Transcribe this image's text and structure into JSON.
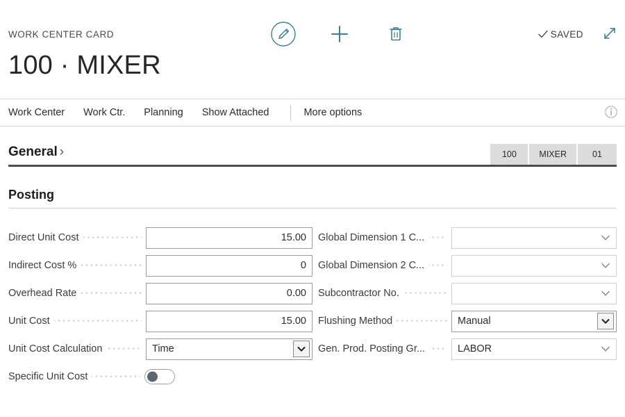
{
  "header": {
    "eyebrow": "WORK CENTER CARD",
    "title": "100 · MIXER",
    "saved_label": "SAVED",
    "icons": {
      "edit": "pencil-circle-icon",
      "new": "plus-icon",
      "delete": "trash-icon",
      "saved_check": "check-icon",
      "expand": "expand-arrows-icon"
    }
  },
  "tabbar": {
    "tabs": [
      {
        "label": "Work Center"
      },
      {
        "label": "Work Ctr."
      },
      {
        "label": "Planning"
      },
      {
        "label": "Show Attached"
      }
    ],
    "more_label": "More options",
    "info_icon": "info-icon"
  },
  "general": {
    "label": "General",
    "chevron": "›",
    "chips": [
      {
        "label": "100"
      },
      {
        "label": "MIXER"
      },
      {
        "label": "01"
      }
    ]
  },
  "posting": {
    "heading": "Posting",
    "left_fields": [
      {
        "label": "Direct Unit Cost",
        "value": "15.00",
        "type": "number",
        "border": "strong"
      },
      {
        "label": "Indirect Cost %",
        "value": "0",
        "type": "number",
        "border": "strong"
      },
      {
        "label": "Overhead Rate",
        "value": "0.00",
        "type": "number",
        "border": "strong"
      },
      {
        "label": "Unit Cost",
        "value": "15.00",
        "type": "number",
        "border": "strong"
      },
      {
        "label": "Unit Cost Calculation",
        "value": "Time",
        "type": "select-boxed",
        "border": "strong"
      },
      {
        "label": "Specific Unit Cost",
        "value": "",
        "type": "toggle",
        "toggle_on": false
      }
    ],
    "right_fields": [
      {
        "label": "Global Dimension 1 C...",
        "value": "",
        "type": "select-plain",
        "border": "light"
      },
      {
        "label": "Global Dimension 2 C...",
        "value": "",
        "type": "select-plain",
        "border": "light"
      },
      {
        "label": "Subcontractor No.",
        "value": "",
        "type": "select-plain",
        "border": "light"
      },
      {
        "label": "Flushing Method",
        "value": "Manual",
        "type": "select-boxed",
        "border": "strong"
      },
      {
        "label": "Gen. Prod. Posting Gr...",
        "value": "LABOR",
        "type": "select-plain",
        "border": "light"
      }
    ]
  },
  "colors": {
    "accent": "#2e7d8f",
    "chip_bg": "#dcdcdc",
    "rule": "#444e59",
    "text": "#2b2b2b"
  }
}
